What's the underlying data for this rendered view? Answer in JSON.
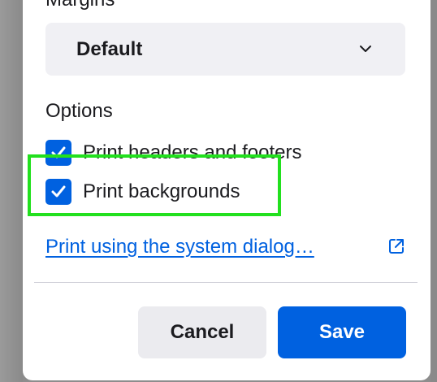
{
  "margins": {
    "title": "Margins",
    "selected": "Default"
  },
  "options": {
    "title": "Options",
    "items": [
      {
        "label": "Print headers and footers",
        "checked": true
      },
      {
        "label": "Print backgrounds",
        "checked": true
      }
    ]
  },
  "system_dialog_link": "Print using the system dialog…",
  "buttons": {
    "cancel": "Cancel",
    "save": "Save"
  },
  "colors": {
    "accent": "#0061e0",
    "highlight": "#22e01e"
  },
  "icons": {
    "dropdown": "chevron-down-icon",
    "checkbox": "checkmark-icon",
    "external": "open-external-icon"
  }
}
